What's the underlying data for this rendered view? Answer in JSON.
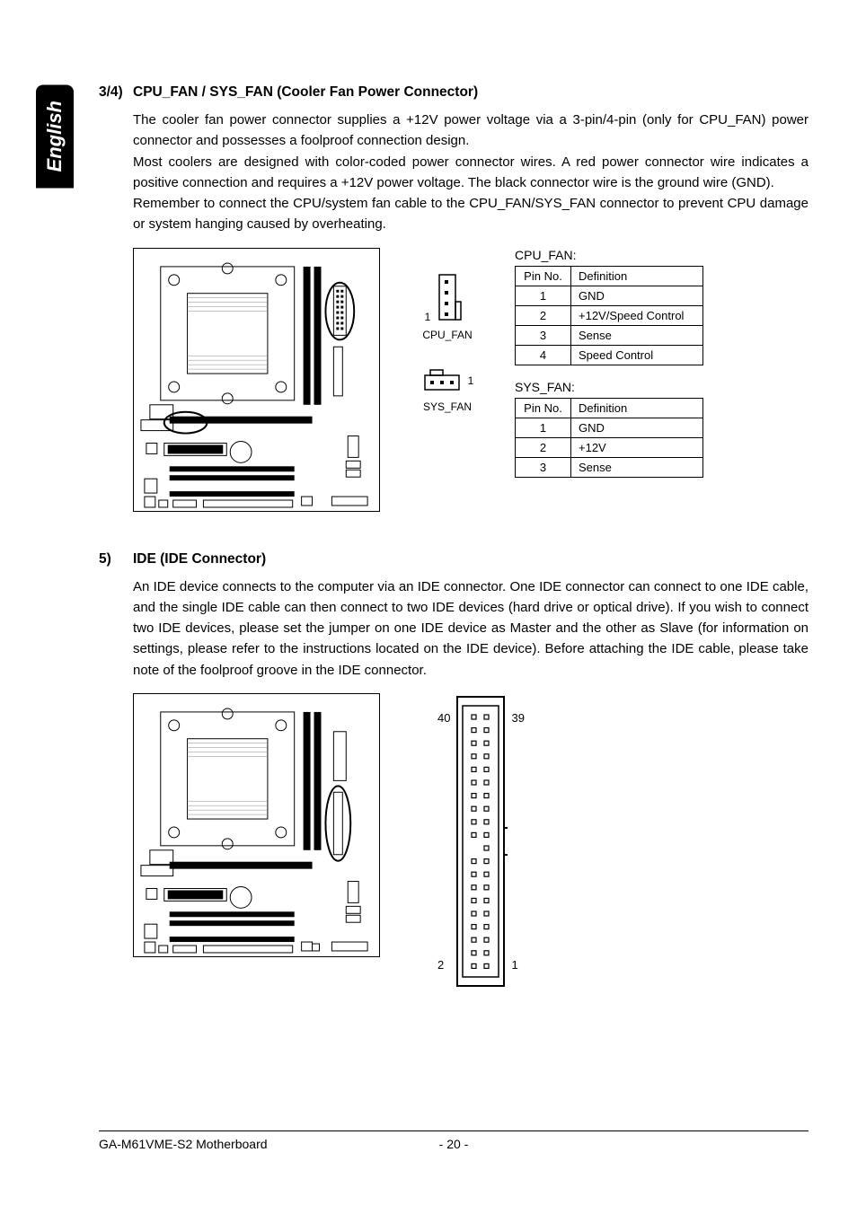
{
  "lang_tab": "English",
  "section1": {
    "num": "3/4)",
    "title": "CPU_FAN / SYS_FAN (Cooler Fan Power Connector)",
    "para": "The cooler fan power connector supplies a +12V power voltage via a 3-pin/4-pin (only for CPU_FAN) power connector and possesses a foolproof connection design.\nMost coolers are designed with color-coded power connector wires. A red power connector wire indicates a positive connection and requires a +12V power voltage. The black connector wire is the ground wire (GND).\nRemember to connect the CPU/system fan cable to the CPU_FAN/SYS_FAN connector to prevent CPU damage or system hanging caused by overheating."
  },
  "conn_labels": {
    "cpu_fan": "CPU_FAN",
    "sys_fan": "SYS_FAN",
    "pin1": "1",
    "pin1b": "1"
  },
  "cpu_fan_table": {
    "title": "CPU_FAN:",
    "head": [
      "Pin No.",
      "Definition"
    ],
    "rows": [
      [
        "1",
        "GND"
      ],
      [
        "2",
        "+12V/Speed Control"
      ],
      [
        "3",
        "Sense"
      ],
      [
        "4",
        "Speed Control"
      ]
    ]
  },
  "sys_fan_table": {
    "title": "SYS_FAN:",
    "head": [
      "Pin No.",
      "Definition"
    ],
    "rows": [
      [
        "1",
        "GND"
      ],
      [
        "2",
        "+12V"
      ],
      [
        "3",
        "Sense"
      ]
    ]
  },
  "section2": {
    "num": "5)",
    "title": "IDE (IDE Connector)",
    "para": "An IDE device connects to the computer via an IDE connector. One IDE connector can connect to one IDE cable, and the single IDE cable can then connect to two IDE devices (hard drive or optical drive). If you wish to connect two IDE devices, please set the jumper on one IDE device as Master and the other as Slave (for information on settings, please refer to the instructions located on the IDE device). Before attaching the IDE cable, please take note of the foolproof groove in the IDE connector."
  },
  "ide_labels": {
    "tl": "40",
    "tr": "39",
    "bl": "2",
    "br": "1"
  },
  "footer": {
    "left": "GA-M61VME-S2 Motherboard",
    "center": "- 20 -"
  }
}
